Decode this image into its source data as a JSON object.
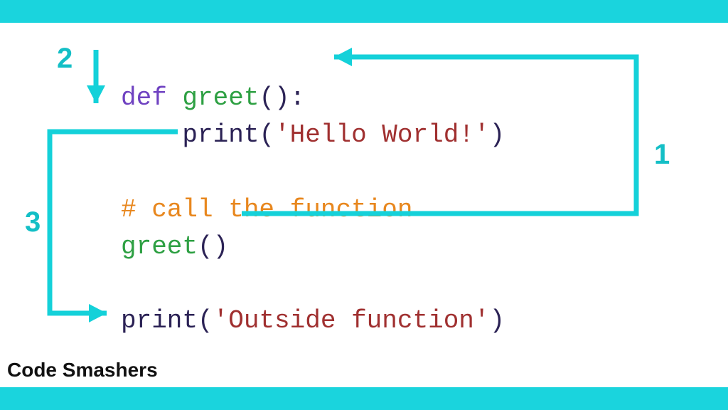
{
  "colors": {
    "accent": "#1ad4dd",
    "keyword": "#6f42c1",
    "function": "#2ea043",
    "paren": "#2b2255",
    "string": "#a03030",
    "comment": "#e8871e"
  },
  "code": {
    "line1": {
      "def": "def ",
      "fname": "greet",
      "parens": "():"
    },
    "line2": {
      "indent": "    ",
      "call": "print",
      "open": "(",
      "str": "'Hello World!'",
      "close": ")"
    },
    "line3": "",
    "line4": {
      "indent": "",
      "comment": "# call the function"
    },
    "line5": {
      "fname": "greet",
      "parens": "()"
    },
    "line6": "",
    "line7": {
      "call": "print",
      "open": "(",
      "str": "'Outside function'",
      "close": ")"
    }
  },
  "steps": {
    "label1": "1",
    "label2": "2",
    "label3": "3"
  },
  "footer": "Code Smashers"
}
